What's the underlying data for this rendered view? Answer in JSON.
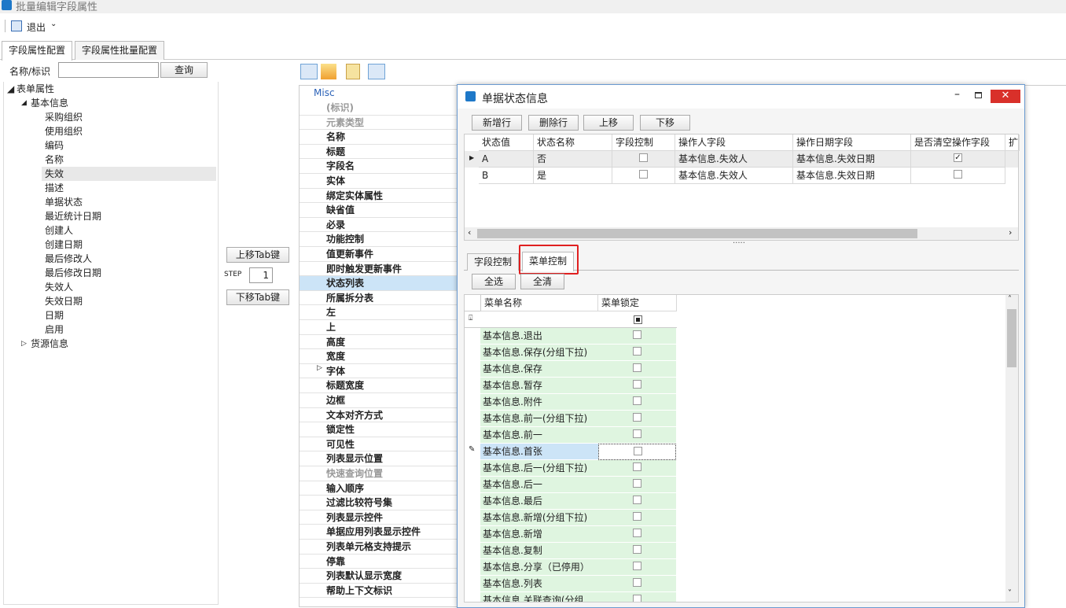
{
  "window": {
    "title": "批量编辑字段属性"
  },
  "toolbar": {
    "exit_label": "退出"
  },
  "tabs": [
    {
      "label": "字段属性配置"
    },
    {
      "label": "字段属性批量配置"
    }
  ],
  "search": {
    "label": "名称/标识",
    "value": "",
    "button": "查询"
  },
  "tree": {
    "root": "表单属性",
    "group1": "基本信息",
    "items": [
      "采购组织",
      "使用组织",
      "编码",
      "名称",
      "失效",
      "描述",
      "单据状态",
      "最近统计日期",
      "创建人",
      "创建日期",
      "最后修改人",
      "最后修改日期",
      "失效人",
      "失效日期",
      "日期",
      "启用"
    ],
    "group2": "货源信息"
  },
  "tabkeys": {
    "up": "上移Tab键",
    "step_label": "STEP",
    "step_value": "1",
    "down": "下移Tab键"
  },
  "props": {
    "category": "Misc",
    "rows": [
      "(标识)",
      "元素类型",
      "名称",
      "标题",
      "字段名",
      "实体",
      "绑定实体属性",
      "缺省值",
      "必录",
      "功能控制",
      "值更新事件",
      "即时触发更新事件",
      "状态列表",
      "所属拆分表",
      "左",
      "上",
      "高度",
      "宽度",
      "字体",
      "标题宽度",
      "边框",
      "文本对齐方式",
      "锁定性",
      "可见性",
      "列表显示位置",
      "快速查询位置",
      "输入顺序",
      "过滤比较符号集",
      "列表显示控件",
      "单据应用列表显示控件",
      "列表单元格支持提示",
      "停靠",
      "列表默认显示宽度",
      "帮助上下文标识"
    ]
  },
  "dialog": {
    "title": "单据状态信息",
    "buttons": [
      "新增行",
      "删除行",
      "上移",
      "下移"
    ],
    "columns": [
      "状态值",
      "状态名称",
      "字段控制",
      "操作人字段",
      "操作日期字段",
      "是否清空操作字段",
      "扩"
    ],
    "rows": [
      {
        "value": "A",
        "name": "否",
        "field_ctrl": false,
        "op_field": "基本信息.失效人",
        "date_field": "基本信息.失效日期",
        "clear": true
      },
      {
        "value": "B",
        "name": "是",
        "field_ctrl": false,
        "op_field": "基本信息.失效人",
        "date_field": "基本信息.失效日期",
        "clear": false
      }
    ],
    "splitter": "·····",
    "subtabs": [
      "字段控制",
      "菜单控制"
    ],
    "select_all": "全选",
    "clear_all": "全清",
    "menu_columns": [
      "菜单名称",
      "菜单锁定"
    ],
    "menu_items": [
      "基本信息.退出",
      "基本信息.保存(分组下拉)",
      "基本信息.保存",
      "基本信息.暂存",
      "基本信息.附件",
      "基本信息.前一(分组下拉)",
      "基本信息.前一",
      "基本信息.首张",
      "基本信息.后一(分组下拉)",
      "基本信息.后一",
      "基本信息.最后",
      "基本信息.新增(分组下拉)",
      "基本信息.新增",
      "基本信息.复制",
      "基本信息.分享（已停用）",
      "基本信息.列表",
      "基本信息.关联查询(分组"
    ]
  },
  "colors": {
    "highlight_border": "#e02020",
    "green_row": "#dff5e0",
    "selected_blue": "#cce4f7"
  }
}
